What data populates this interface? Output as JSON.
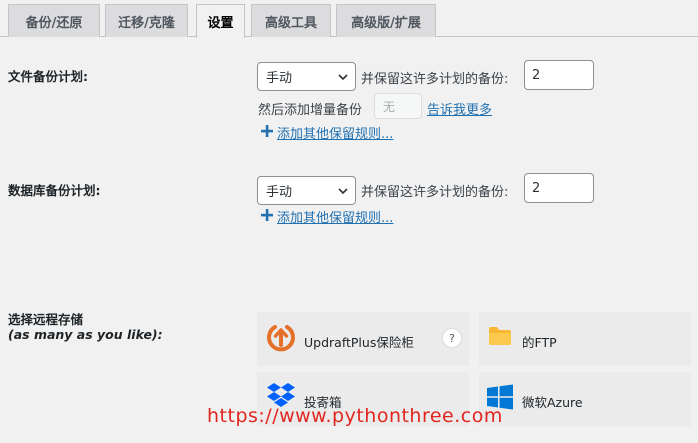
{
  "tabs": [
    {
      "label": "备份/还原",
      "active": false
    },
    {
      "label": "迁移/克隆",
      "active": false
    },
    {
      "label": "设置",
      "active": true
    },
    {
      "label": "高级工具",
      "active": false
    },
    {
      "label": "高级版/扩展",
      "active": false
    }
  ],
  "file_backup": {
    "label": "文件备份计划:",
    "schedule_value": "手动",
    "retain_text": "并保留这许多计划的备份:",
    "retain_value": "2",
    "incremental_text": "然后添加增量备份",
    "incremental_value": "无",
    "learn_more": "告诉我更多",
    "add_rule": "添加其他保留规则..."
  },
  "db_backup": {
    "label": "数据库备份计划:",
    "schedule_value": "手动",
    "retain_text": "并保留这许多计划的备份:",
    "retain_value": "2",
    "add_rule": "添加其他保留规则..."
  },
  "remote_storage": {
    "label": "选择远程存储",
    "sublabel": "(as many as you like):",
    "options": [
      {
        "label": "UpdraftPlus保险柜",
        "icon": "updraftplus-vault-icon",
        "help": "?"
      },
      {
        "label": "的FTP",
        "icon": "folder-icon"
      },
      {
        "label": "投寄箱",
        "icon": "dropbox-icon"
      },
      {
        "label": "微软Azure",
        "icon": "azure-windows-icon"
      }
    ]
  },
  "watermark": "https://www.pythonthree.com",
  "colors": {
    "link": "#2271b1",
    "updraft_orange": "#e5702a",
    "dropbox_blue": "#0061fe",
    "azure_blue": "#0078d4",
    "folder_yellow": "#f7b733",
    "watermark_red": "#e0261f"
  }
}
